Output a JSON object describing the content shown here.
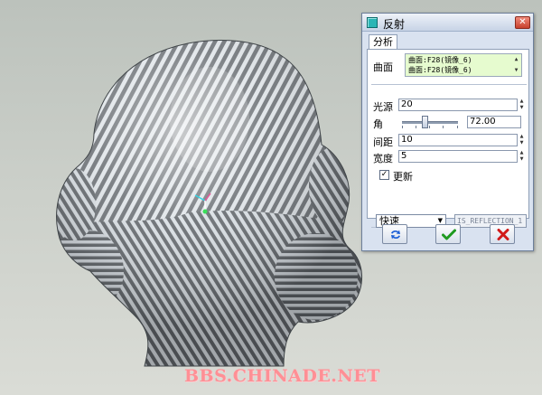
{
  "watermark": "BBS.CHINADE.NET",
  "dialog": {
    "title": "反射",
    "close_glyph": "✕",
    "tab": "分析",
    "surface_label": "曲面",
    "surfaces": [
      "曲面:F28(镜像_6)",
      "曲面:F28(镜像_6)"
    ],
    "light_source_label": "光源",
    "light_source_value": "20",
    "angle_label": "角",
    "angle_value": "72.00",
    "angle_slider_fraction": 0.4,
    "spacing_label": "间距",
    "spacing_value": "10",
    "width_label": "宽度",
    "width_value": "5",
    "update_label": "更新",
    "update_checked": true,
    "quality_value": "快速",
    "analysis_name": "IS_REFLECTION_1",
    "buttons": {
      "repeat_icon": "repeat-arrows-icon",
      "ok_icon": "green-checkmark-icon",
      "cancel_icon": "red-x-icon"
    },
    "colors": {
      "accent_title_icon": "#2ab5b5",
      "ok": "#1f9a1f",
      "cancel": "#d11a1a",
      "surface_list_bg": "#e6fbcf"
    }
  }
}
